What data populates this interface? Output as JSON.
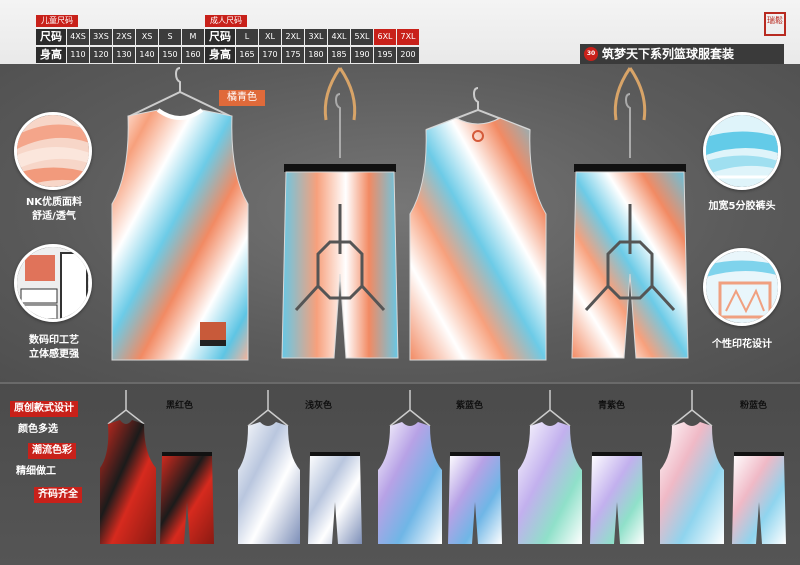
{
  "kids_sizes": {
    "tag": "儿童尺码",
    "size_label": "尺码",
    "height_label": "身高",
    "sizes": [
      "4XS",
      "3XS",
      "2XS",
      "XS",
      "S",
      "M"
    ],
    "heights": [
      "110",
      "120",
      "130",
      "140",
      "150",
      "160"
    ]
  },
  "adult_sizes": {
    "tag": "成人尺码",
    "size_label": "尺码",
    "height_label": "身高",
    "sizes": [
      "L",
      "XL",
      "2XL",
      "3XL",
      "4XL",
      "5XL",
      "6XL",
      "7XL"
    ],
    "heights": [
      "165",
      "170",
      "175",
      "180",
      "185",
      "190",
      "195",
      "200"
    ]
  },
  "seal_text": "瑞鬆",
  "series": {
    "badge": "30",
    "title": "筑梦天下系列篮球服套装"
  },
  "main_color_name": "橘青色",
  "features": {
    "fabric": "NK优质面料\n舒适/透气",
    "print": "数码印工艺\n立体感更强",
    "waistband": "加宽5分胶裤头",
    "pattern": "个性印花设计"
  },
  "bottom_tags": {
    "original": "原创款式设计",
    "colors": "颜色多选",
    "trend": "潮流色彩",
    "craft": "精细做工",
    "sizes": "齐码齐全"
  },
  "variants": [
    {
      "name": "黑红色",
      "primary": "#d62a1e",
      "secondary": "#1b1b1b"
    },
    {
      "name": "浅灰色",
      "primary": "#b9c6de",
      "secondary": "#7d8fb8"
    },
    {
      "name": "紫蓝色",
      "primary": "#b7a2e6",
      "secondary": "#6fb6e6"
    },
    {
      "name": "青紫色",
      "primary": "#c2b0ee",
      "secondary": "#8fe0c9"
    },
    {
      "name": "粉蓝色",
      "primary": "#f0b9c6",
      "secondary": "#8fd4ee"
    }
  ],
  "colors": {
    "accent_red": "#c8211a",
    "orange": "#f3865d",
    "cyan": "#5cc7e6"
  }
}
